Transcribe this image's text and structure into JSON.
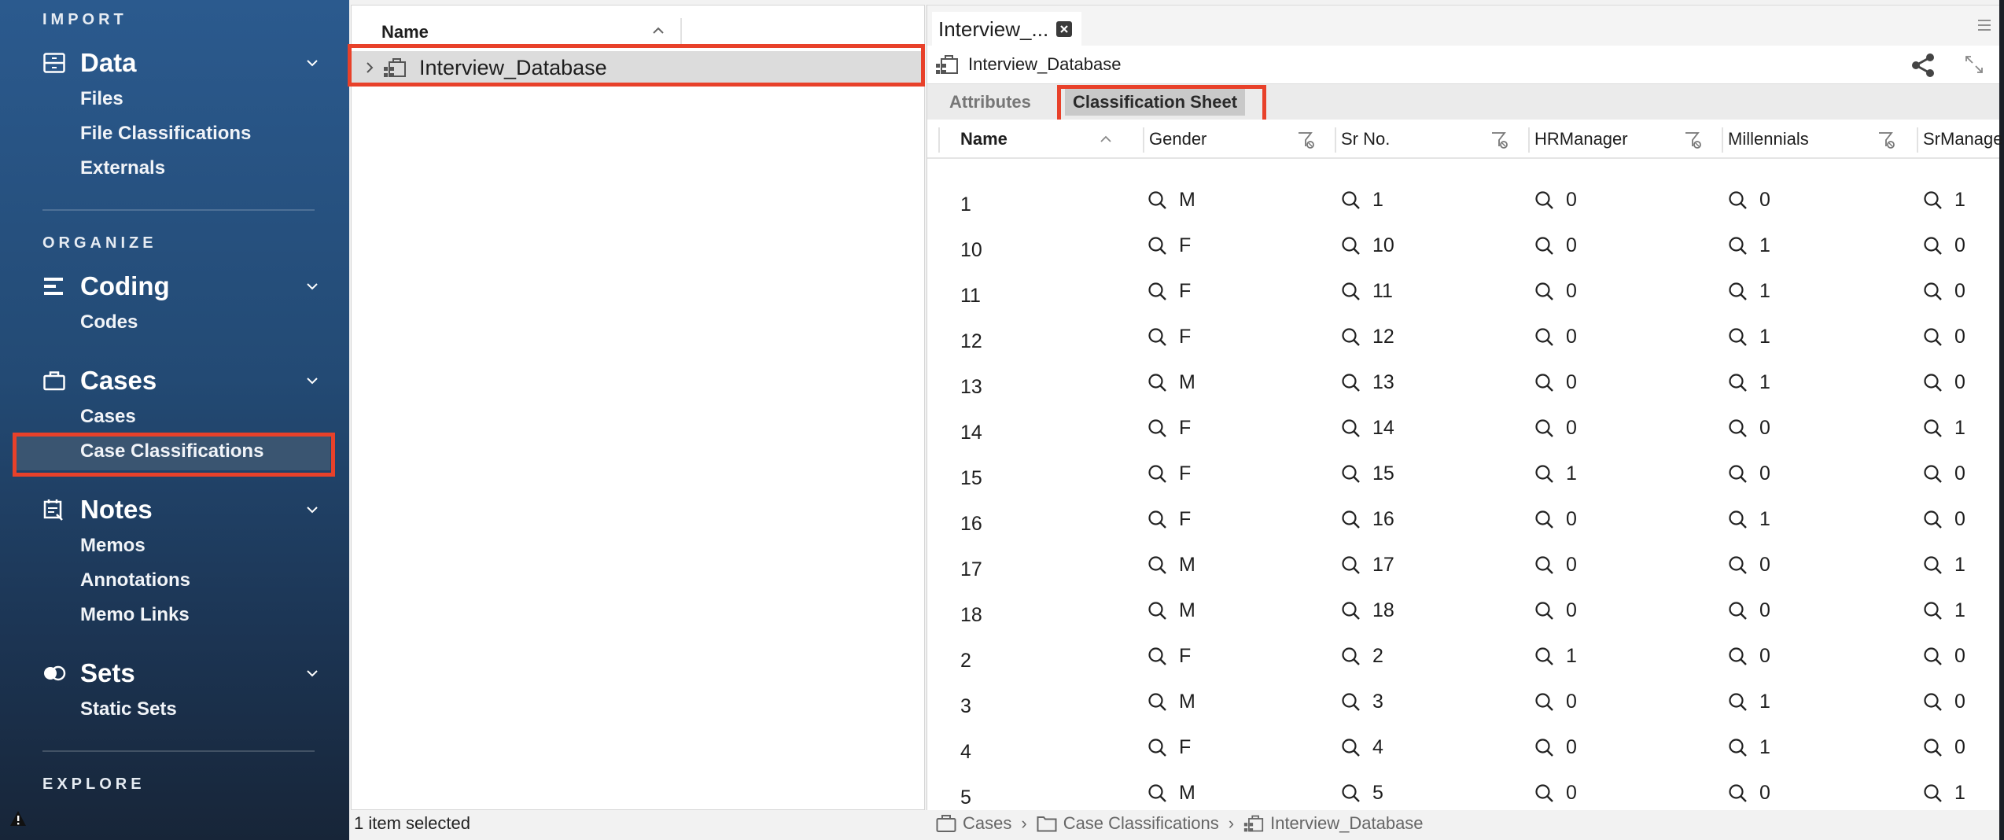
{
  "sidebar": {
    "sections": {
      "import": "IMPORT",
      "organize": "ORGANIZE",
      "explore": "EXPLORE"
    },
    "groups": {
      "data": {
        "label": "Data",
        "items": [
          "Files",
          "File Classifications",
          "Externals"
        ]
      },
      "coding": {
        "label": "Coding",
        "items": [
          "Codes"
        ]
      },
      "cases": {
        "label": "Cases",
        "items": [
          "Cases",
          "Case Classifications"
        ]
      },
      "notes": {
        "label": "Notes",
        "items": [
          "Memos",
          "Annotations",
          "Memo Links"
        ]
      },
      "sets": {
        "label": "Sets",
        "items": [
          "Static Sets"
        ]
      }
    },
    "active_item": "Case Classifications"
  },
  "navigator": {
    "column_header": "Name",
    "rows": [
      {
        "label": "Interview_Database",
        "selected": true
      }
    ],
    "status": "1 item selected"
  },
  "detail": {
    "tab_label": "Interview_...",
    "title": "Interview_Database",
    "subtabs": {
      "attributes": "Attributes",
      "sheet": "Classification Sheet"
    },
    "active_subtab": "Classification Sheet",
    "columns": [
      "Name",
      "Gender",
      "Sr No.",
      "HRManager",
      "Millennials",
      "SrManage"
    ],
    "rows": [
      [
        "1",
        "M",
        "1",
        "0",
        "0",
        "1"
      ],
      [
        "10",
        "F",
        "10",
        "0",
        "1",
        "0"
      ],
      [
        "11",
        "F",
        "11",
        "0",
        "1",
        "0"
      ],
      [
        "12",
        "F",
        "12",
        "0",
        "1",
        "0"
      ],
      [
        "13",
        "M",
        "13",
        "0",
        "1",
        "0"
      ],
      [
        "14",
        "F",
        "14",
        "0",
        "0",
        "1"
      ],
      [
        "15",
        "F",
        "15",
        "1",
        "0",
        "0"
      ],
      [
        "16",
        "F",
        "16",
        "0",
        "1",
        "0"
      ],
      [
        "17",
        "M",
        "17",
        "0",
        "0",
        "1"
      ],
      [
        "18",
        "M",
        "18",
        "0",
        "0",
        "1"
      ],
      [
        "2",
        "F",
        "2",
        "1",
        "0",
        "0"
      ],
      [
        "3",
        "M",
        "3",
        "0",
        "1",
        "0"
      ],
      [
        "4",
        "F",
        "4",
        "0",
        "1",
        "0"
      ],
      [
        "5",
        "M",
        "5",
        "0",
        "0",
        "1"
      ]
    ],
    "breadcrumb": [
      "Cases",
      "Case Classifications",
      "Interview_Database"
    ]
  },
  "colors": {
    "highlight_box": "#e8412a",
    "sidebar_top": "#2b5a8e",
    "sidebar_bottom": "#172538",
    "sidebar_active": "#3a5571"
  }
}
